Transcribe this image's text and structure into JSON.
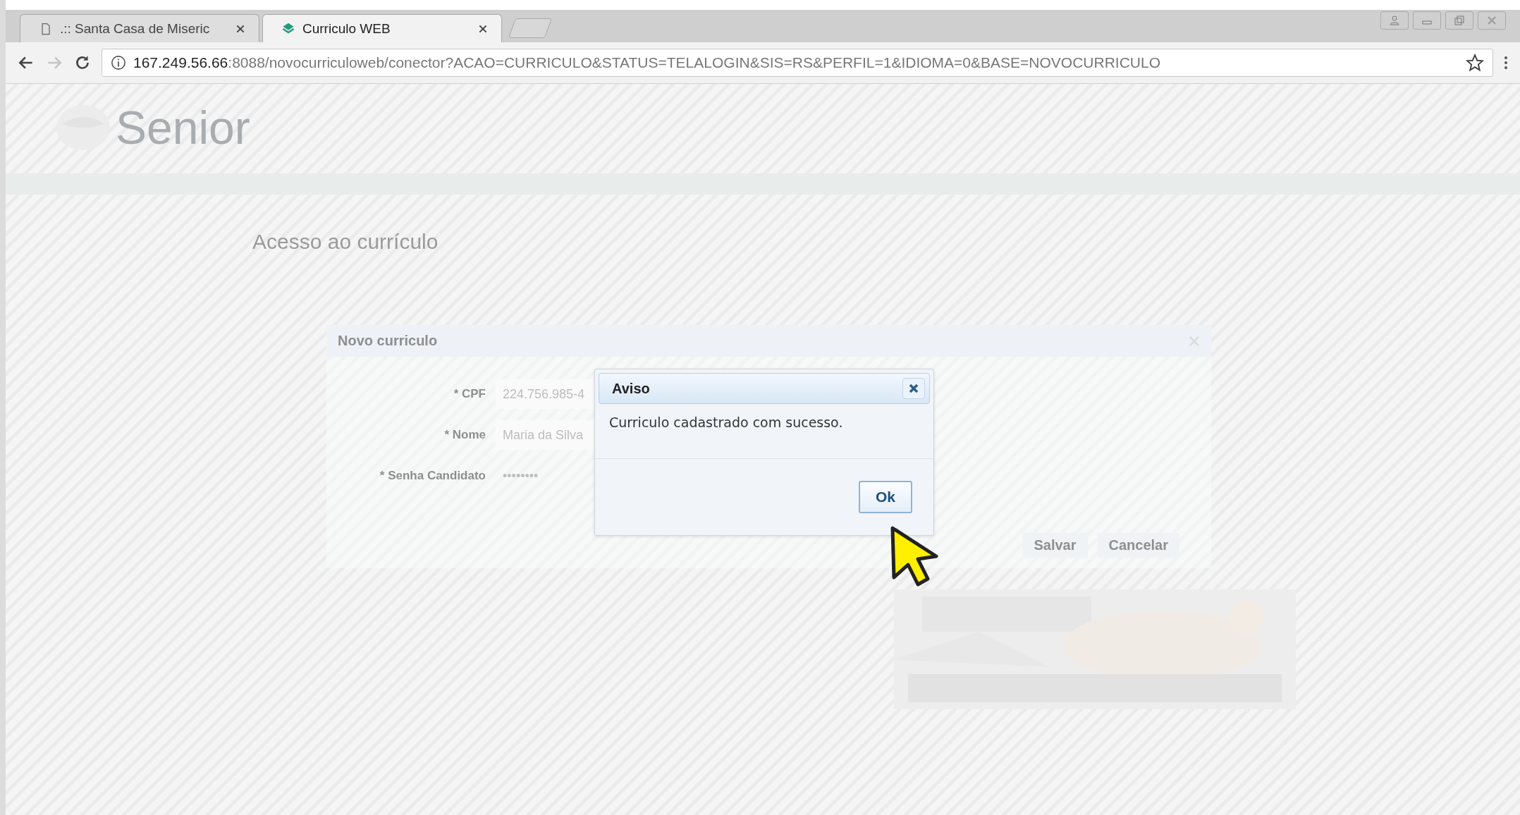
{
  "browser": {
    "tabs": [
      {
        "title": ".:: Santa Casa de Miseric",
        "selected": false
      },
      {
        "title": "Curriculo WEB",
        "selected": true
      }
    ],
    "url_host": "167.249.56.66",
    "url_rest": ":8088/novocurriculoweb/conector?ACAO=CURRICULO&STATUS=TELALOGIN&SIS=RS&PERFIL=1&IDIOMA=0&BASE=NOVOCURRICULO"
  },
  "page": {
    "logo": "Senior",
    "heading": "Acesso ao currículo",
    "panel": {
      "title": "Novo curriculo",
      "fields": [
        {
          "label": "* CPF",
          "value": "224.756.985-4",
          "kind": "input"
        },
        {
          "label": "* Nome",
          "value": "Maria da Silva",
          "kind": "input"
        },
        {
          "label": "* Senha Candidato",
          "value": "••••••••",
          "kind": "password"
        }
      ],
      "buttons": [
        "Salvar",
        "Cancelar"
      ]
    }
  },
  "dialog": {
    "title": "Aviso",
    "message": "Curriculo cadastrado com sucesso.",
    "button": "Ok"
  }
}
